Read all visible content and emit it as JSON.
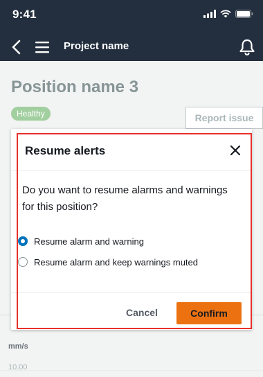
{
  "status_bar": {
    "time": "9:41",
    "icons": [
      "cellular-signal-icon",
      "wifi-icon",
      "battery-icon"
    ]
  },
  "app_bar": {
    "title": "Project name",
    "icons": [
      "back-icon",
      "menu-icon",
      "bell-icon"
    ]
  },
  "underlay": {
    "position_title": "Position name 3",
    "health_badge": "Healthy",
    "report_button": "Report issue",
    "unit_label": "mm/s",
    "axis_tick": "10.00"
  },
  "dialog": {
    "title": "Resume alerts",
    "question": "Do you want to resume alarms and warnings for this position?",
    "options": [
      {
        "label": "Resume alarm and warning",
        "selected": true
      },
      {
        "label": "Resume alarm and keep warnings muted",
        "selected": false
      }
    ],
    "cancel_label": "Cancel",
    "confirm_label": "Confirm"
  },
  "colors": {
    "header_bg": "#232f3e",
    "accent": "#0073bb",
    "confirm": "#ec7211",
    "focus_ring": "#e8312a",
    "badge_bg": "#a2cf9f"
  }
}
